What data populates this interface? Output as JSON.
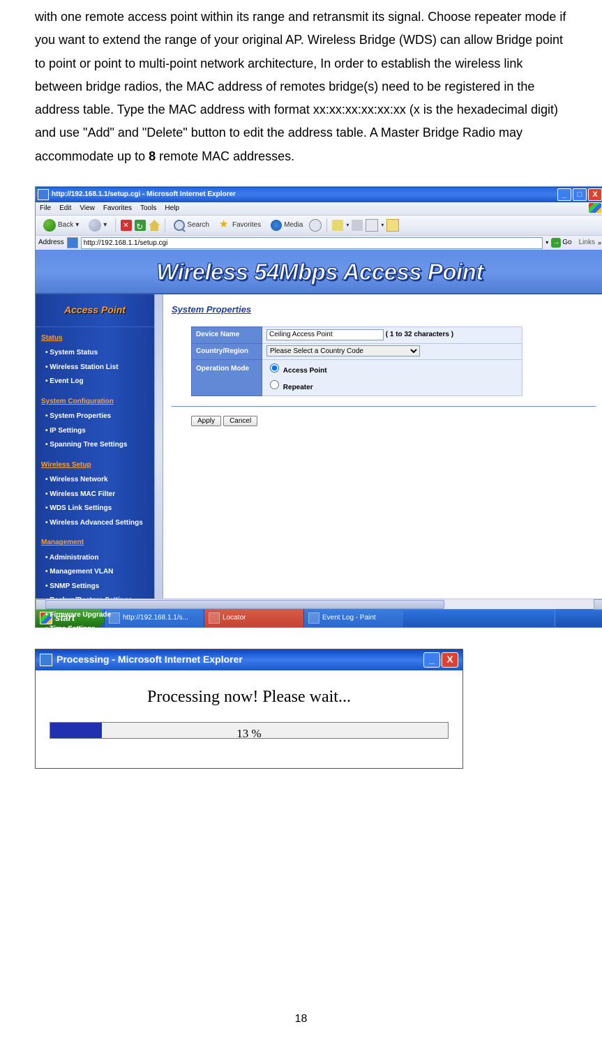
{
  "doc": {
    "para1": "with one remote access point within its range and retransmit its signal. Choose repeater mode if you want to extend the range of your original AP. Wireless Bridge (WDS) can allow Bridge point to point or point to multi-point network architecture, In order to establish the wireless link between bridge radios, the MAC address of remotes bridge(s) need to be registered in the address table.    Type the MAC address with format xx:xx:xx:xx:xx:xx (x is the hexadecimal digit) and use \"Add\" and \"Delete\" button to edit the address table.    A Master Bridge Radio may accommodate up to ",
    "bold_num": "8",
    "para1_tail": " remote MAC addresses."
  },
  "ie": {
    "title": "http://192.168.1.1/setup.cgi - Microsoft Internet Explorer",
    "menu": {
      "file": "File",
      "edit": "Edit",
      "view": "View",
      "favorites": "Favorites",
      "tools": "Tools",
      "help": "Help"
    },
    "toolbar": {
      "back": "Back",
      "search": "Search",
      "favorites": "Favorites",
      "media": "Media"
    },
    "addr_label": "Address",
    "url": "http://192.168.1.1/setup.cgi",
    "go": "Go",
    "links": "Links"
  },
  "banner": "Wireless 54Mbps Access Point",
  "sidebar": {
    "header": "Access Point",
    "groups": [
      {
        "title": "Status",
        "items": [
          "System Status",
          "Wireless Station List",
          "Event Log"
        ]
      },
      {
        "title": "System Configuration",
        "items": [
          "System Properties",
          "IP Settings",
          "Spanning Tree Settings"
        ]
      },
      {
        "title": "Wireless Setup",
        "items": [
          "Wireless Network",
          "Wireless MAC Filter",
          "WDS Link Settings",
          "Wireless Advanced Settings"
        ]
      },
      {
        "title": "Management",
        "items": [
          "Administration",
          "Management VLAN",
          "SNMP Settings",
          "Backup/Restore Settings",
          "Firmware Upgrade",
          "Time Settings"
        ]
      }
    ]
  },
  "panel": {
    "section_title": "System Properties",
    "labels": {
      "device_name": "Device Name",
      "country": "Country/Region",
      "opmode": "Operation Mode"
    },
    "device_name_value": "Ceiling Access Point",
    "device_name_note": "( 1 to 32 characters )",
    "country_value": "Please Select a Country Code",
    "op_ap": "Access Point",
    "op_rep": "Repeater",
    "apply": "Apply",
    "cancel": "Cancel"
  },
  "taskbar": {
    "start": "start",
    "t1": "http://192.168.1.1/s...",
    "t2": "Locator",
    "t3": "Event Log - Paint"
  },
  "popup": {
    "title": "Processing - Microsoft Internet Explorer",
    "msg": "Processing now! Please wait...",
    "percent": "13 %"
  },
  "page_num": "18"
}
